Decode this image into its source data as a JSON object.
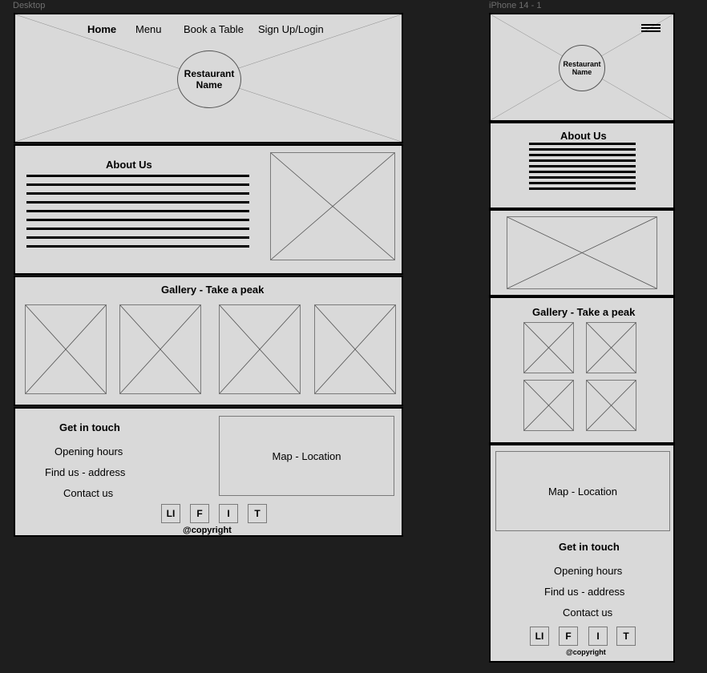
{
  "frames": {
    "desktop_label": "Desktop",
    "mobile_label": "iPhone 14 - 1"
  },
  "nav": {
    "home": "Home",
    "menu": "Menu",
    "book": "Book a Table",
    "signup": "Sign Up/Login"
  },
  "hero": {
    "name_line1": "Restaurant",
    "name_line2": "Name"
  },
  "about": {
    "title": "About Us"
  },
  "gallery": {
    "title": "Gallery - Take a peak"
  },
  "contact": {
    "title": "Get in touch",
    "opening": "Opening hours",
    "address": "Find us - address",
    "contact": "Contact us",
    "map": "Map - Location"
  },
  "social": {
    "li": "LI",
    "f": "F",
    "i": "I",
    "t": "T"
  },
  "footer": {
    "copyright": "@copyright"
  },
  "icons": {
    "menu": "hamburger-icon",
    "placeholder": "image-placeholder-icon"
  }
}
